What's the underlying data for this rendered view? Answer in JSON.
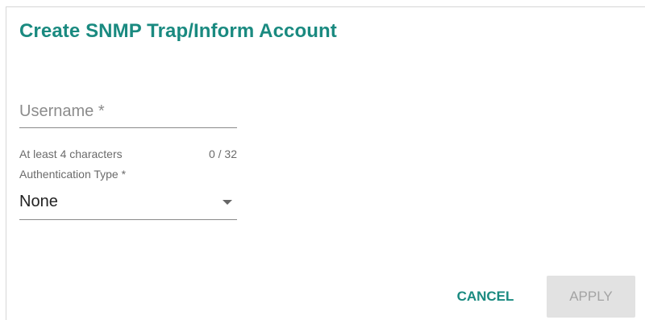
{
  "dialog": {
    "title": "Create SNMP Trap/Inform Account"
  },
  "username": {
    "placeholder": "Username *",
    "value": "",
    "hint": "At least 4 characters",
    "counter": "0 / 32"
  },
  "authentication": {
    "label": "Authentication Type *",
    "selected": "None",
    "icon": "chevron-down-icon"
  },
  "actions": {
    "cancel_label": "CANCEL",
    "apply_label": "APPLY"
  },
  "colors": {
    "accent": "#1a8a80",
    "disabled_bg": "#e2e2e2",
    "disabled_text": "#a3a3a3"
  }
}
